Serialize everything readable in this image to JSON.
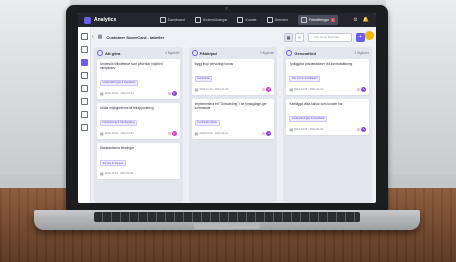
{
  "header": {
    "logo": "Analytics",
    "nav": [
      {
        "label": "Dashboard",
        "active": false
      },
      {
        "label": "Undersökningar",
        "active": false
      },
      {
        "label": "Kunder",
        "active": false
      },
      {
        "label": "Ärenden",
        "active": false
      },
      {
        "label": "Förbättringar",
        "active": true,
        "badge": "1"
      }
    ],
    "icons": [
      "settings-icon",
      "notifications-icon"
    ]
  },
  "toolbar": {
    "board_title": "Customer ScoreCard - tabeller",
    "search_placeholder": "Sök bland åtgärder",
    "add_label": "+",
    "more_label": "⋮"
  },
  "columns": [
    {
      "title": "Att göra",
      "count": "4 åtgärder",
      "cards": [
        {
          "title": "Undersök tillkräftenar som påverkar nöjdhet i inköpsvarv",
          "tag": "Undersökningar & Feedback",
          "dates": "2024-10-01 - 2024-10-24",
          "avatar": "A"
        },
        {
          "title": "Utöka möjligheterna till felrapportering",
          "tag": "Felhantering & Återkoppling",
          "dates": "2024-10-01 - 2024-12-31",
          "avatar": "A"
        },
        {
          "title": "Standardisera felmingar",
          "tag": "Service & Support",
          "dates": "2024-11-01 - 2024-12-31",
          "avatar": ""
        }
      ]
    },
    {
      "title": "Påbörjad",
      "count": "2 åtgärder",
      "cards": [
        {
          "title": "Bygg ihop personligt bonus",
          "tag": "Kundvärde",
          "dates": "2024-10-01 - 2024-11-30",
          "avatar": "A"
        },
        {
          "title": "Implementera ett \"Onboarding\" i de fyrasgänge-ger kommande",
          "tag": "Kundupplevelsen",
          "dates": "2024-10-01 - 2024-11-21",
          "avatar": "A"
        }
      ]
    },
    {
      "title": "Genomförd",
      "count": "2 åtgärder",
      "cards": [
        {
          "title": "Tydliggöra prisvariationer vid kontrollsättning",
          "tag": "Pris & Kommunikation",
          "dates": "2024-10-01 - 2024-10-31",
          "avatar": "A"
        },
        {
          "title": "Kartlägga vilka kalvar som kunder har",
          "tag": "Undersökningar & Feedback",
          "dates": "2024-09-01 - 2024-09-30",
          "avatar": "A"
        }
      ]
    }
  ]
}
